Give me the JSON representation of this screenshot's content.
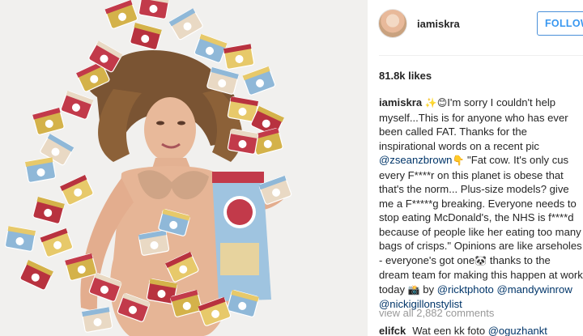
{
  "post": {
    "username": "iamiskra",
    "follow_label": "FOLLOW",
    "likes": "81.8k likes"
  },
  "caption": {
    "username": "iamiskra",
    "emoji_1": "✨😊",
    "text_1": "I'm sorry I couldn't help myself...This is for anyone who has ever been called FAT. Thanks for the inspirational words on a recent pic ",
    "mention_1": "@zseanzbrown",
    "emoji_2": "👇",
    "text_2": " \"Fat cow. It's only cus every F****r on this planet is obese that that's the norm... Plus-size models? give me a F*****g breaking. Everyone needs to stop eating McDonald's, the NHS is f****d because of people like her eating too many bags of crisps.\" Opinions are like arseholes - everyone's got one",
    "emoji_3": "🐼",
    "text_3": " thanks to the dream team for making this happen at work today ",
    "emoji_4": "📸",
    "text_4": " by ",
    "mention_2": "@ricktphoto",
    "mention_3": "@mandywinrow",
    "mention_4": "@nickigillonstylist"
  },
  "comments": {
    "view_all": "view all 2,882 comments",
    "items": [
      {
        "user": "elifck",
        "text": "Wat een kk foto ",
        "mention": "@oguzhankt"
      }
    ]
  },
  "image": {
    "background": "#f1f0ee",
    "bag_colors": [
      "#d4b24a",
      "#c23a4a",
      "#e9d9c4",
      "#8fb8d8",
      "#e7c96a",
      "#b8323f"
    ]
  }
}
